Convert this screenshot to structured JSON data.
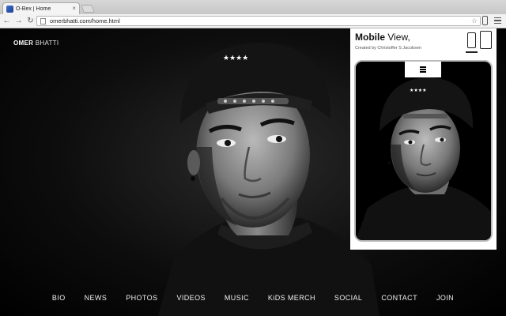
{
  "browser": {
    "tab_title": "O-Bex | Home",
    "tab_close": "×",
    "url": "omerbhatti.com/home.html",
    "star": "☆",
    "back_glyph": "←",
    "forward_glyph": "→",
    "reload_glyph": "↻"
  },
  "site": {
    "brand_bold": "OMER",
    "brand_light": "BHATTI",
    "nav": [
      "BIO",
      "NEWS",
      "PHOTOS",
      "VIDEOS",
      "MUSIC",
      "KiDS MERCH",
      "SOCIAL",
      "CONTACT",
      "JOIN"
    ]
  },
  "mobile_view": {
    "title_bold": "Mobile",
    "title_rest": " View,",
    "credit": "Created by Christoffer S Jacobsen"
  },
  "colors": {
    "page_bg": "#000000",
    "panel_bg": "#ffffff"
  }
}
